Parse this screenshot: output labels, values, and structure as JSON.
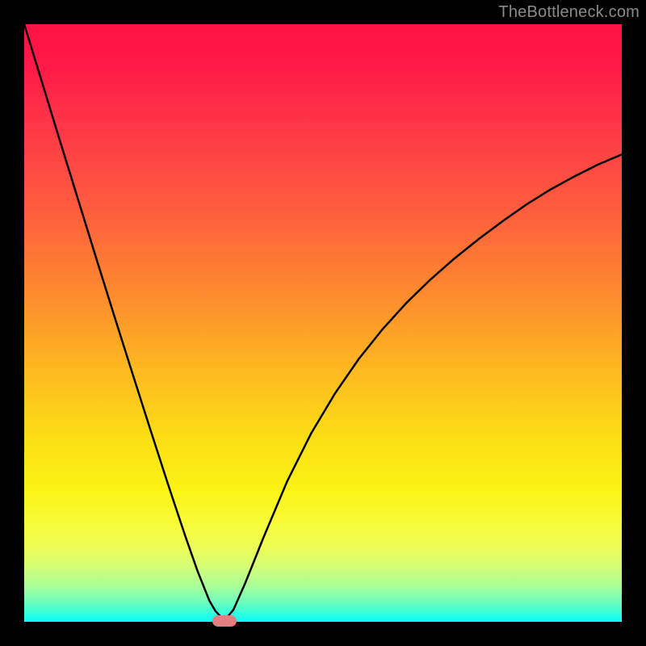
{
  "watermark": "TheBottleneck.com",
  "colors": {
    "background": "#000000",
    "curve": "#000000",
    "marker": "#e08080"
  },
  "chart_data": {
    "type": "line",
    "title": "",
    "xlabel": "",
    "ylabel": "",
    "xlim": [
      0,
      1
    ],
    "ylim": [
      0,
      1
    ],
    "grid": false,
    "legend": false,
    "annotations": [],
    "series": [
      {
        "name": "curve",
        "x": [
          0.0,
          0.03,
          0.06,
          0.09,
          0.12,
          0.15,
          0.18,
          0.21,
          0.24,
          0.27,
          0.29,
          0.31,
          0.32,
          0.335,
          0.35,
          0.37,
          0.4,
          0.44,
          0.48,
          0.52,
          0.56,
          0.6,
          0.64,
          0.68,
          0.72,
          0.76,
          0.8,
          0.84,
          0.88,
          0.92,
          0.96,
          1.0
        ],
        "values": [
          1.0,
          0.902,
          0.804,
          0.707,
          0.61,
          0.514,
          0.419,
          0.325,
          0.232,
          0.142,
          0.085,
          0.035,
          0.018,
          0.002,
          0.02,
          0.065,
          0.14,
          0.235,
          0.315,
          0.382,
          0.44,
          0.49,
          0.534,
          0.573,
          0.608,
          0.64,
          0.67,
          0.698,
          0.723,
          0.745,
          0.765,
          0.782
        ]
      }
    ],
    "marker": {
      "x": 0.335,
      "y": 0.002
    },
    "background_gradient": [
      {
        "stop": 0.0,
        "color": "#ff1245"
      },
      {
        "stop": 0.16,
        "color": "#ff3448"
      },
      {
        "stop": 0.3,
        "color": "#fe5a3e"
      },
      {
        "stop": 0.45,
        "color": "#fe8a2f"
      },
      {
        "stop": 0.58,
        "color": "#feb920"
      },
      {
        "stop": 0.7,
        "color": "#fbe014"
      },
      {
        "stop": 0.84,
        "color": "#f7fc3d"
      },
      {
        "stop": 0.94,
        "color": "#a9ff98"
      },
      {
        "stop": 1.0,
        "color": "#07fff8"
      }
    ]
  }
}
